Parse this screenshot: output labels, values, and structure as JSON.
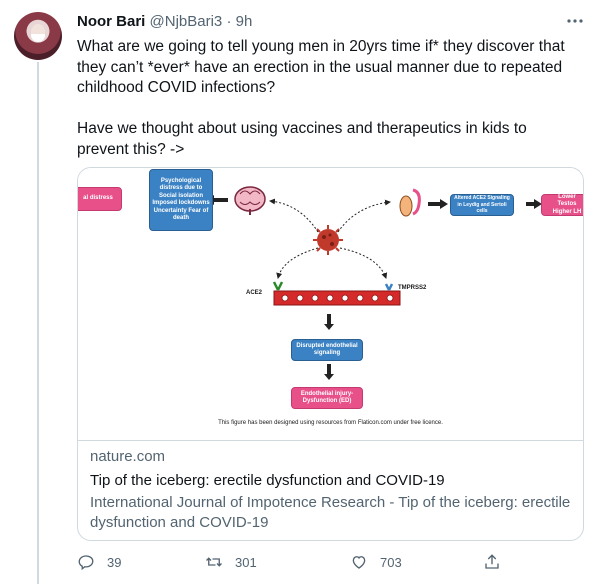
{
  "tweet": {
    "author_name": "Noor Bari",
    "author_handle": "@NjbBari3",
    "separator": "·",
    "time": "9h",
    "more_icon": "ellipsis-icon",
    "text": "What are we going to tell young men in 20yrs time if* they discover that they can’t *ever* have an erection in the usual manner due to repeated childhood COVID infections?\n\nHave we thought about using vaccines and therapeutics in kids to prevent this? ->"
  },
  "card": {
    "figure": {
      "left_box": "al distress",
      "psych_box": "Psychological distress due to Social isolation Imposed lockdowns Uncertainty Fear of death",
      "ace2_box": "Altered ACE2 Signaling in Leydig and Sertoli cells",
      "right_box": "Lower Testos Higher LH",
      "ace2_label": "ACE2",
      "tmprss2_label": "TMPRSS2",
      "endo_box": "Disrupted endothelial signaling",
      "ed_box": "Endothelial injury- Dysfunction (ED)",
      "credit": "This figure has been designed using resources from Flaticon.com under free licence."
    },
    "domain": "nature.com",
    "title": "Tip of the iceberg: erectile dysfunction and COVID-19",
    "description": "International Journal of Impotence Research - Tip of the iceberg: erectile dysfunction and COVID-19"
  },
  "actions": {
    "replies": "39",
    "retweets": "301",
    "likes": "703"
  },
  "colors": {
    "accent_blue": "#3b82c4",
    "accent_pink": "#e8508a",
    "virus_red": "#c0392b",
    "muted_text": "#536471"
  }
}
